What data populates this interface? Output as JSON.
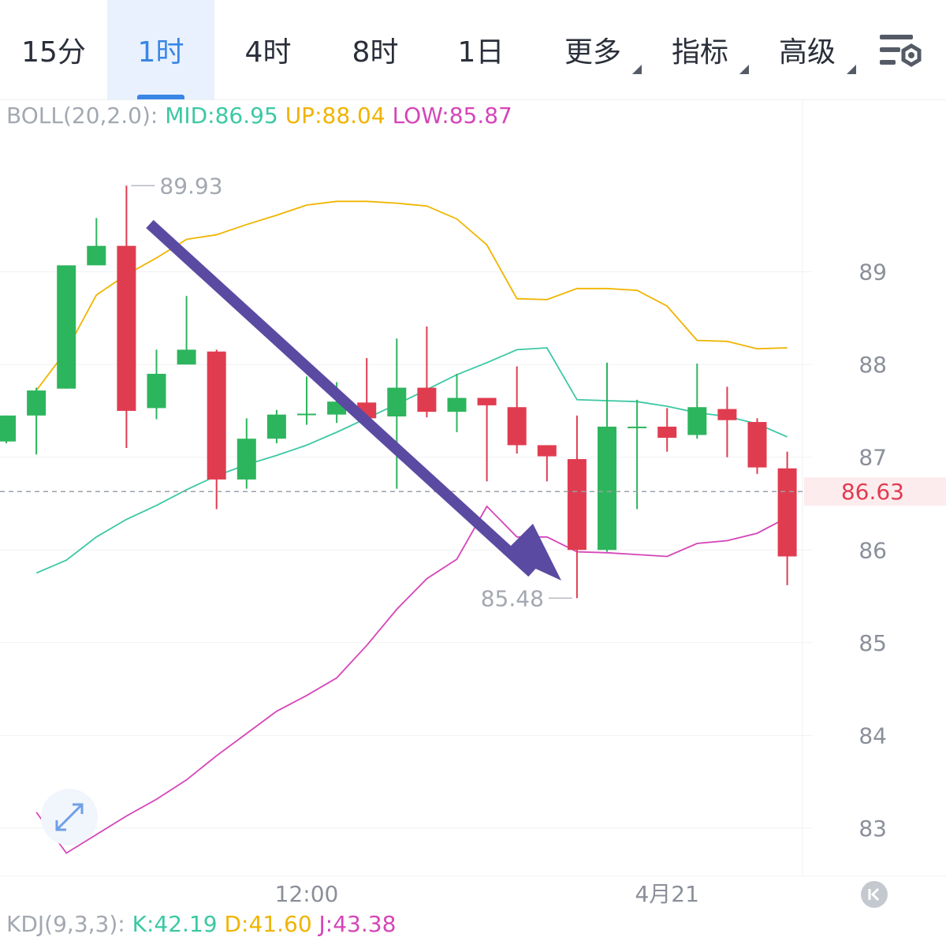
{
  "tabs": [
    {
      "label": "15分",
      "active": false,
      "dropdown": false
    },
    {
      "label": "1时",
      "active": true,
      "dropdown": false
    },
    {
      "label": "4时",
      "active": false,
      "dropdown": false
    },
    {
      "label": "8时",
      "active": false,
      "dropdown": false
    },
    {
      "label": "1日",
      "active": false,
      "dropdown": false
    },
    {
      "label": "更多",
      "active": false,
      "dropdown": true
    },
    {
      "label": "指标",
      "active": false,
      "dropdown": true
    },
    {
      "label": "高级",
      "active": false,
      "dropdown": true
    }
  ],
  "settings_icon": "chart-settings-icon",
  "boll_legend": {
    "name": "BOLL(20,2.0):",
    "mid": "MID:86.95",
    "up": "UP:88.04",
    "low": "LOW:85.87",
    "colors": {
      "mid": "#3cc8a4",
      "up": "#f0b400",
      "low": "#d645b8"
    }
  },
  "kdj_legend": {
    "name": "KDJ(9,3,3):",
    "k": "K:42.19",
    "d": "D:41.60",
    "j": "J:43.38",
    "colors": {
      "k": "#3cc8a4",
      "d": "#f0b400",
      "j": "#d645b8"
    }
  },
  "chart_data": {
    "type": "candlestick",
    "y_ticks": [
      89,
      88,
      87,
      86,
      85,
      84,
      83
    ],
    "ylim": [
      82.48,
      90.86
    ],
    "x_labels": [
      {
        "label": "12:00",
        "index": 10
      },
      {
        "label": "4月21",
        "index": 22
      }
    ],
    "last_price": {
      "value": 86.63,
      "label": "86.63",
      "color": "#e03c50"
    },
    "high_label": {
      "value": 89.93,
      "label": "89.93",
      "index": 4
    },
    "low_label": {
      "value": 85.48,
      "label": "85.48",
      "index": 19
    },
    "colors": {
      "up": "#2db55d",
      "down": "#e03c50"
    },
    "candles": [
      {
        "o": 87.17,
        "h": 87.35,
        "l": 87.15,
        "c": 87.45
      },
      {
        "o": 87.45,
        "h": 87.75,
        "l": 87.03,
        "c": 87.72
      },
      {
        "o": 87.74,
        "h": 89.07,
        "l": 87.74,
        "c": 89.07
      },
      {
        "o": 89.07,
        "h": 89.58,
        "l": 89.07,
        "c": 89.28
      },
      {
        "o": 89.28,
        "h": 89.93,
        "l": 87.1,
        "c": 87.5
      },
      {
        "o": 87.53,
        "h": 88.16,
        "l": 87.41,
        "c": 87.9
      },
      {
        "o": 88.0,
        "h": 88.74,
        "l": 88.0,
        "c": 88.16
      },
      {
        "o": 88.14,
        "h": 88.16,
        "l": 86.44,
        "c": 86.76
      },
      {
        "o": 86.76,
        "h": 87.42,
        "l": 86.66,
        "c": 87.2
      },
      {
        "o": 87.2,
        "h": 87.51,
        "l": 87.15,
        "c": 87.46
      },
      {
        "o": 87.46,
        "h": 87.87,
        "l": 87.35,
        "c": 87.47
      },
      {
        "o": 87.46,
        "h": 87.81,
        "l": 87.37,
        "c": 87.6
      },
      {
        "o": 87.59,
        "h": 88.07,
        "l": 87.47,
        "c": 87.42
      },
      {
        "o": 87.44,
        "h": 88.28,
        "l": 86.66,
        "c": 87.75
      },
      {
        "o": 87.75,
        "h": 88.41,
        "l": 87.43,
        "c": 87.49
      },
      {
        "o": 87.49,
        "h": 87.9,
        "l": 87.27,
        "c": 87.64
      },
      {
        "o": 87.64,
        "h": 87.64,
        "l": 86.74,
        "c": 87.56
      },
      {
        "o": 87.54,
        "h": 87.98,
        "l": 87.04,
        "c": 87.13
      },
      {
        "o": 87.13,
        "h": 87.13,
        "l": 86.74,
        "c": 87.01
      },
      {
        "o": 86.98,
        "h": 87.45,
        "l": 85.48,
        "c": 86.0
      },
      {
        "o": 86.0,
        "h": 88.02,
        "l": 85.98,
        "c": 87.33
      },
      {
        "o": 87.33,
        "h": 87.62,
        "l": 86.44,
        "c": 87.33
      },
      {
        "o": 87.33,
        "h": 87.53,
        "l": 87.06,
        "c": 87.21
      },
      {
        "o": 87.24,
        "h": 88.01,
        "l": 87.2,
        "c": 87.54
      },
      {
        "o": 87.52,
        "h": 87.76,
        "l": 87.0,
        "c": 87.4
      },
      {
        "o": 87.38,
        "h": 87.42,
        "l": 86.82,
        "c": 86.89
      },
      {
        "o": 86.88,
        "h": 87.06,
        "l": 85.62,
        "c": 85.93
      }
    ],
    "series": [
      {
        "name": "UP",
        "color": "#f0b400",
        "values": [
          null,
          87.72,
          88.15,
          88.75,
          88.97,
          89.15,
          89.35,
          89.4,
          89.51,
          89.61,
          89.72,
          89.76,
          89.76,
          89.74,
          89.71,
          89.57,
          89.29,
          88.71,
          88.7,
          88.82,
          88.82,
          88.8,
          88.63,
          88.26,
          88.25,
          88.17,
          88.18
        ]
      },
      {
        "name": "MID",
        "color": "#3cc8a4",
        "values": [
          null,
          85.75,
          85.89,
          86.14,
          86.33,
          86.48,
          86.65,
          86.8,
          86.92,
          87.02,
          87.13,
          87.27,
          87.42,
          87.57,
          87.73,
          87.89,
          88.02,
          88.16,
          88.18,
          87.62,
          87.61,
          87.6,
          87.55,
          87.48,
          87.44,
          87.36,
          87.22
        ]
      },
      {
        "name": "LOW",
        "color": "#d645b8",
        "values": [
          null,
          83.17,
          82.73,
          82.93,
          83.13,
          83.31,
          83.52,
          83.78,
          84.02,
          84.26,
          84.43,
          84.62,
          84.97,
          85.36,
          85.69,
          85.9,
          86.47,
          86.14,
          86.14,
          85.98,
          85.97,
          85.95,
          85.93,
          86.07,
          86.1,
          86.18,
          86.35
        ]
      }
    ],
    "annotation": {
      "type": "arrow",
      "direction": "down-right",
      "color": "#5b4aa2"
    }
  }
}
